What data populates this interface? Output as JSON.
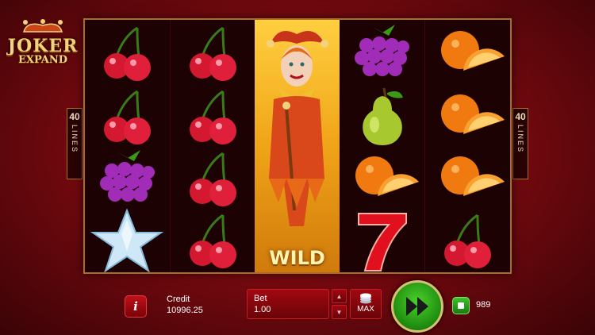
{
  "game": {
    "logo_line1": "JOKER",
    "logo_line2": "EXPAND"
  },
  "lines_badge": {
    "number": "40",
    "label": "LINES"
  },
  "reels": [
    [
      "cherry",
      "cherry",
      "grapes",
      "star"
    ],
    [
      "cherry",
      "cherry",
      "cherry",
      "cherry"
    ],
    [
      "wild-joker"
    ],
    [
      "grapes",
      "pear",
      "orange",
      "seven"
    ],
    [
      "orange",
      "orange",
      "orange",
      "cherry"
    ]
  ],
  "wild_label": "WILD",
  "controls": {
    "info_label": "i",
    "credit_label": "Credit",
    "credit_value": "10996.25",
    "bet_label": "Bet",
    "bet_value": "1.00",
    "max_label": "MAX",
    "autoplay_count": "989"
  },
  "colors": {
    "background": "#8a0b12",
    "frame_gold": "#a8701e",
    "spin_green": "#2ea81a",
    "wild_gold": "#f0a418"
  }
}
